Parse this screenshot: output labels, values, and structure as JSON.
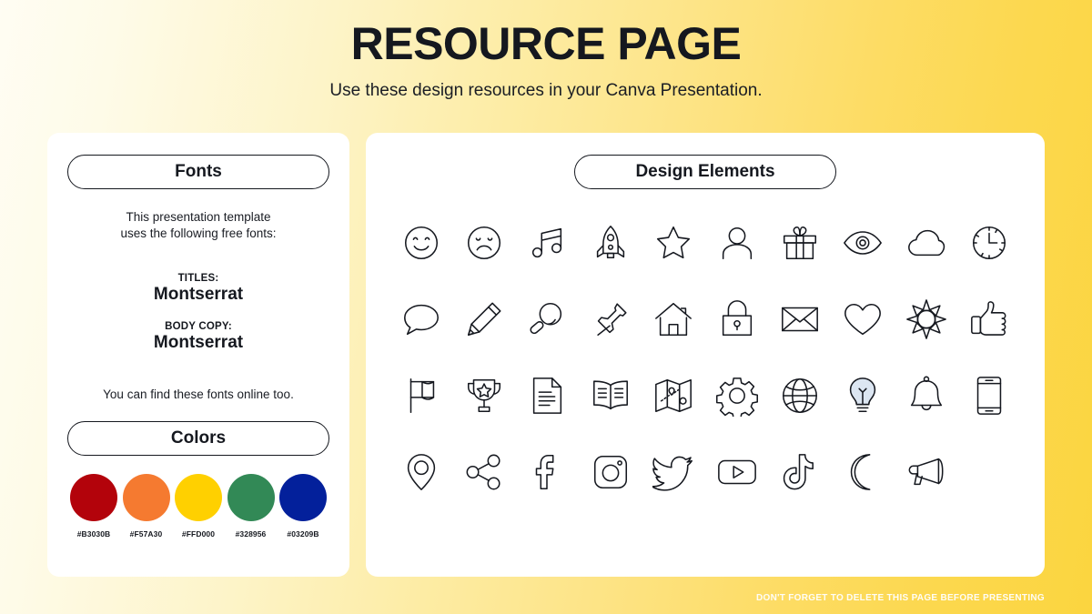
{
  "header": {
    "title": "RESOURCE PAGE",
    "subtitle": "Use these design resources in your Canva Presentation."
  },
  "fonts_panel": {
    "heading": "Fonts",
    "intro_line1": "This presentation template",
    "intro_line2": "uses the following free fonts:",
    "specs": [
      {
        "role": "TITLES:",
        "name": "Montserrat"
      },
      {
        "role": "BODY COPY:",
        "name": "Montserrat"
      }
    ],
    "outro": "You can find these fonts online too."
  },
  "colors_panel": {
    "heading": "Colors",
    "swatches": [
      {
        "hex": "#B3030B",
        "label": "#B3030B"
      },
      {
        "hex": "#F57A30",
        "label": "#F57A30"
      },
      {
        "hex": "#FFD000",
        "label": "#FFD000"
      },
      {
        "hex": "#328956",
        "label": "#328956"
      },
      {
        "hex": "#03209B",
        "label": "#03209B"
      }
    ]
  },
  "elements_panel": {
    "heading": "Design Elements",
    "icons": [
      "smiley-face-icon",
      "sad-face-icon",
      "music-note-icon",
      "rocket-icon",
      "star-icon",
      "person-icon",
      "gift-icon",
      "eye-icon",
      "cloud-icon",
      "clock-icon",
      "speech-bubble-icon",
      "pencil-icon",
      "magnifier-icon",
      "pushpin-icon",
      "house-icon",
      "lock-icon",
      "envelope-icon",
      "heart-icon",
      "sun-icon",
      "thumbs-up-icon",
      "flag-icon",
      "trophy-icon",
      "document-icon",
      "book-icon",
      "map-icon",
      "gear-icon",
      "globe-icon",
      "lightbulb-icon",
      "bell-icon",
      "phone-icon",
      "location-pin-icon",
      "share-icon",
      "facebook-icon",
      "instagram-icon",
      "twitter-icon",
      "youtube-icon",
      "tiktok-icon",
      "moon-icon",
      "megaphone-icon"
    ]
  },
  "footer": {
    "note": "DON'T FORGET TO DELETE THIS PAGE BEFORE PRESENTING"
  }
}
